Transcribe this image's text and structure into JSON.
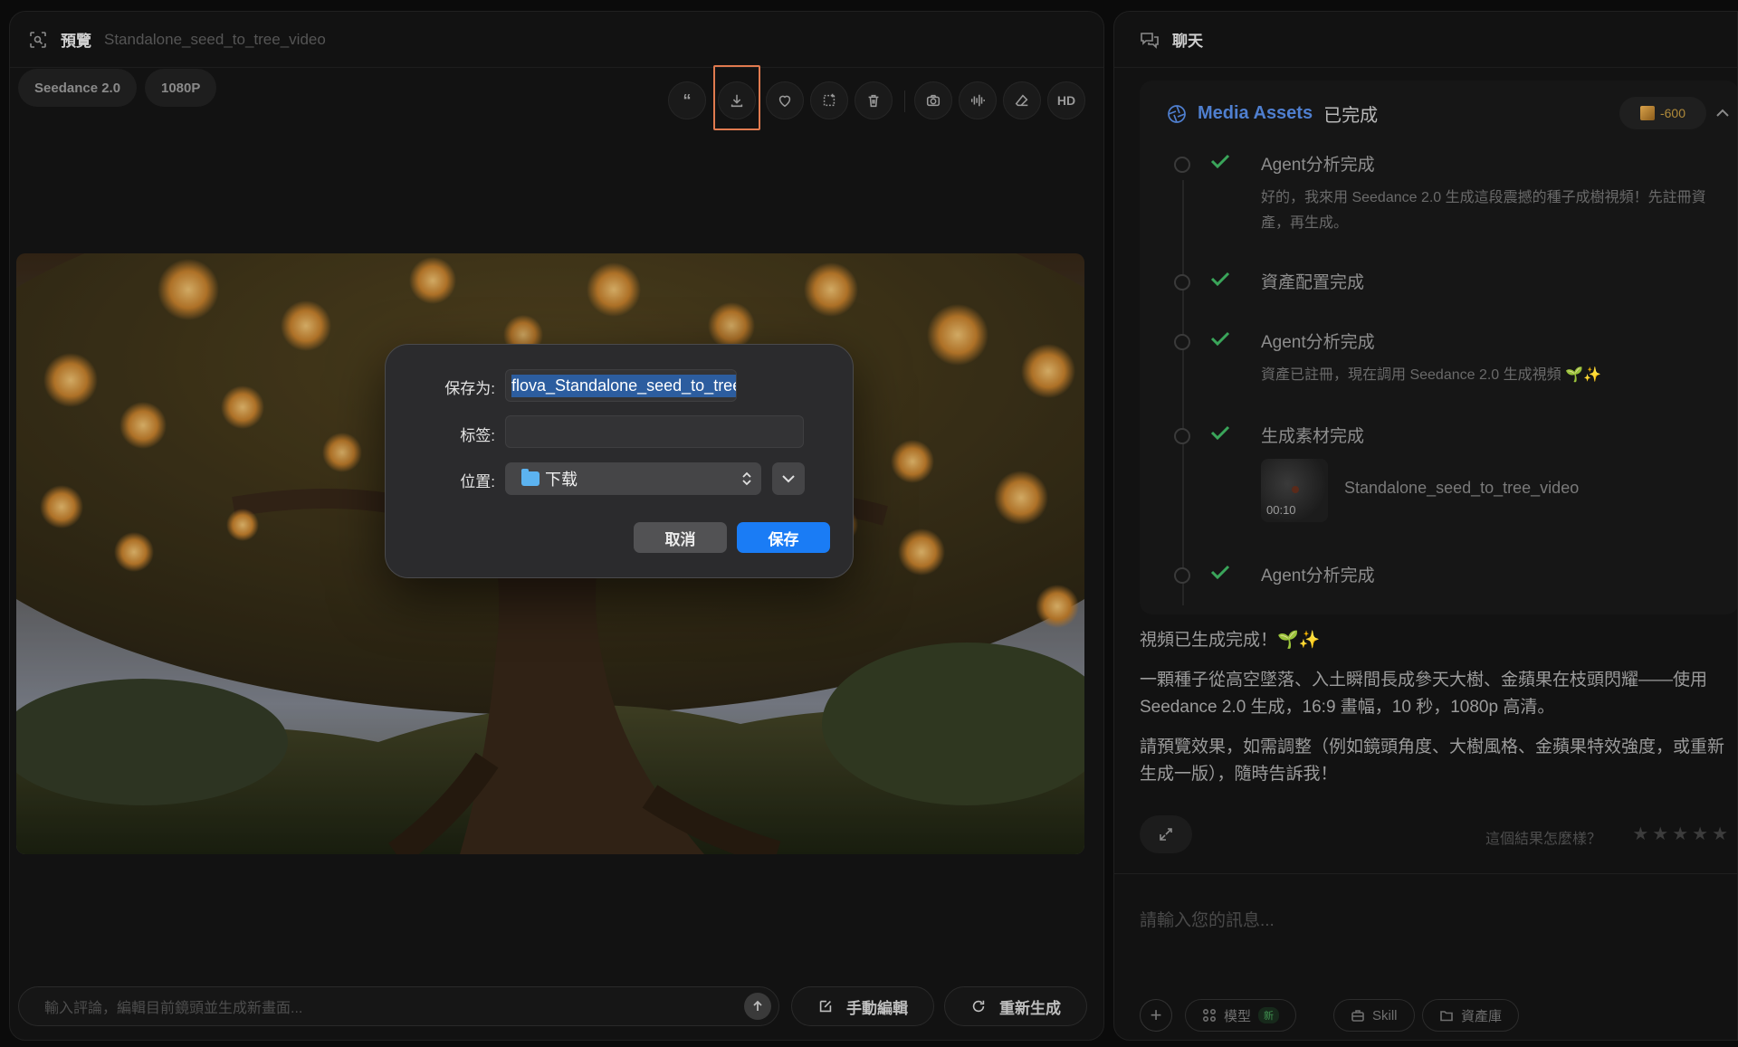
{
  "preview_panel": {
    "title": "預覽",
    "subtitle": "Standalone_seed_to_tree_video",
    "model_chip": "Seedance 2.0",
    "resolution_chip": "1080P",
    "toolbar": {
      "hd_label": "HD",
      "icons": [
        "quote-icon",
        "download-icon",
        "heart-icon",
        "crop-icon",
        "trash-icon",
        "camera-icon",
        "audio-wave-icon",
        "eraser-icon"
      ]
    },
    "comment_placeholder": "輸入評論，編輯目前鏡頭並生成新畫面...",
    "manual_edit_label": "手動編輯",
    "regenerate_label": "重新生成"
  },
  "save_dialog": {
    "save_as_label": "保存为:",
    "save_as_value": "flova_Standalone_seed_to_tree_vide",
    "tags_label": "标签:",
    "tags_value": "",
    "location_label": "位置:",
    "location_value": "下载",
    "cancel_label": "取消",
    "save_label": "保存"
  },
  "chat_panel": {
    "title": "聊天",
    "assets_card": {
      "title": "Media Assets",
      "status": "已完成",
      "credits": "-600",
      "steps": [
        {
          "label": "Agent分析完成",
          "desc": "好的，我來用 Seedance 2.0 生成這段震撼的種子成樹視頻！先註冊資產，再生成。"
        },
        {
          "label": "資產配置完成",
          "desc": ""
        },
        {
          "label": "Agent分析完成",
          "desc": "資產已註冊，現在調用 Seedance 2.0 生成視頻 🌱✨"
        },
        {
          "label": "生成素材完成",
          "desc": ""
        },
        {
          "label": "Agent分析完成",
          "desc": ""
        }
      ],
      "asset": {
        "name": "Standalone_seed_to_tree_video",
        "duration": "00:10"
      }
    },
    "messages": [
      "視頻已生成完成！🌱✨",
      "一顆種子從高空墜落、入土瞬間長成參天大樹、金蘋果在枝頭閃耀——使用 Seedance 2.0 生成，16:9 畫幅，10 秒，1080p 高清。",
      "請預覽效果，如需調整（例如鏡頭角度、大樹風格、金蘋果特效強度，或重新生成一版），隨時告訴我！"
    ],
    "rating_prompt": "這個結果怎麼樣？",
    "stars": [
      "★",
      "★",
      "★",
      "★",
      "★"
    ],
    "input_placeholder": "請輸入您的訊息...",
    "model_label": "模型",
    "new_badge": "新",
    "skill_label": "Skill",
    "asset_library_label": "資產庫"
  },
  "colors": {
    "accent_blue": "#1a7cf5",
    "check_green": "#3aa55a",
    "highlight_orange": "#e07a4f",
    "assets_title_blue": "#4f7fcf"
  }
}
